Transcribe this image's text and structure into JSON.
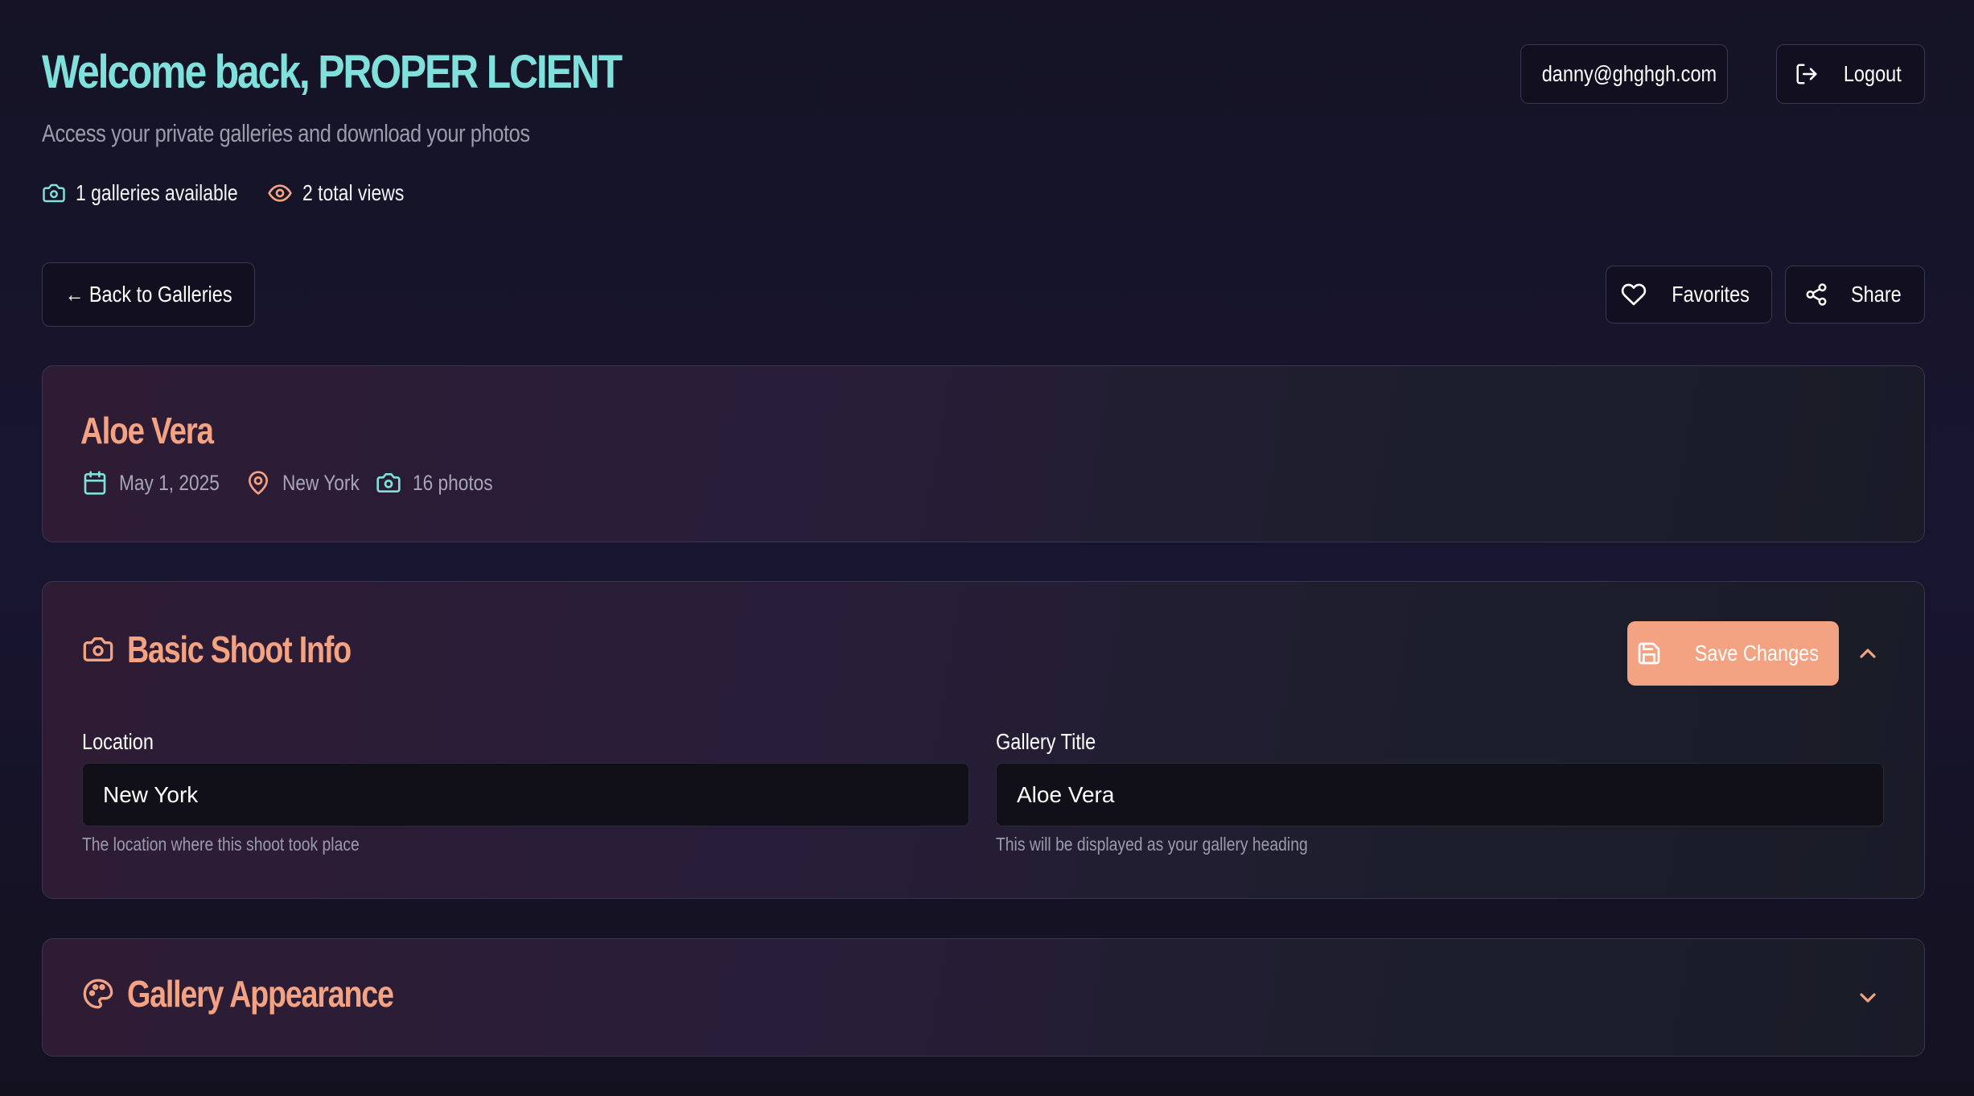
{
  "header": {
    "title": "Welcome back, PROPER LCIENT",
    "subtitle": "Access your private galleries and download your photos",
    "stats": {
      "galleries": "1 galleries available",
      "views": "2 total views"
    },
    "user_email": "danny@ghghgh.com",
    "logout_label": "Logout"
  },
  "toolbar": {
    "back_label": "← Back to Galleries",
    "favorites_label": "Favorites",
    "share_label": "Share"
  },
  "gallery": {
    "name": "Aloe Vera",
    "date": "May 1, 2025",
    "location": "New York",
    "photos": "16 photos"
  },
  "basic_info": {
    "title": "Basic Shoot Info",
    "save_label": "Save Changes",
    "location_label": "Location",
    "location_value": "New York",
    "location_help": "The location where this shoot took place",
    "gallery_title_label": "Gallery Title",
    "gallery_title_value": "Aloe Vera",
    "gallery_title_help": "This will be displayed as your gallery heading"
  },
  "appearance": {
    "title": "Gallery Appearance"
  },
  "colors": {
    "accent_teal": "#7fe0dc",
    "accent_peach": "#f3a382",
    "background": "#16132a"
  },
  "icons": [
    "user-icon",
    "logout-icon",
    "camera-icon",
    "eye-icon",
    "heart-icon",
    "share-icon",
    "calendar-icon",
    "map-pin-icon",
    "save-icon",
    "chevron-up-icon",
    "chevron-down-icon",
    "palette-icon"
  ]
}
